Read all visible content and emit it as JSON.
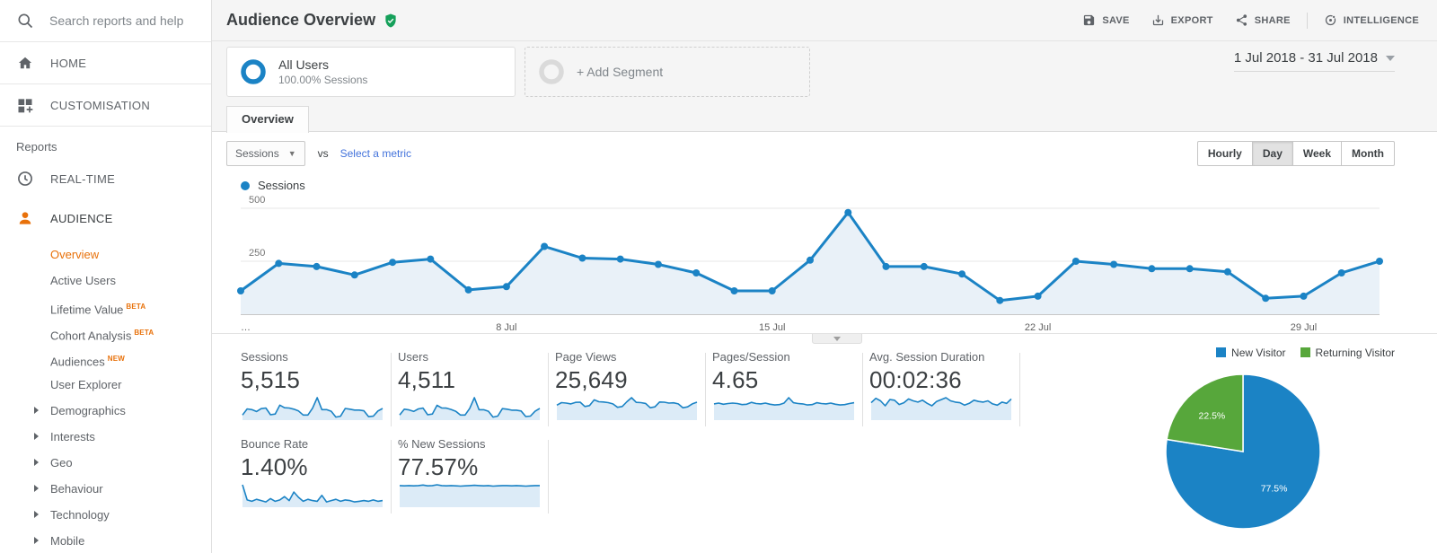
{
  "sidebar": {
    "search_placeholder": "Search reports and help",
    "items": [
      {
        "label": "HOME"
      },
      {
        "label": "CUSTOMISATION"
      }
    ],
    "reports_label": "Reports",
    "report_items": [
      {
        "label": "REAL-TIME"
      },
      {
        "label": "AUDIENCE"
      }
    ],
    "audience_items": [
      {
        "label": "Overview",
        "active": true
      },
      {
        "label": "Active Users"
      },
      {
        "label": "Lifetime Value",
        "badge": "BETA"
      },
      {
        "label": "Cohort Analysis",
        "badge": "BETA"
      },
      {
        "label": "Audiences",
        "badge": "NEW"
      },
      {
        "label": "User Explorer"
      },
      {
        "label": "Demographics",
        "expandable": true
      },
      {
        "label": "Interests",
        "expandable": true
      },
      {
        "label": "Geo",
        "expandable": true
      },
      {
        "label": "Behaviour",
        "expandable": true
      },
      {
        "label": "Technology",
        "expandable": true
      },
      {
        "label": "Mobile",
        "expandable": true
      }
    ]
  },
  "header": {
    "title": "Audience Overview",
    "toolbar": [
      {
        "label": "SAVE"
      },
      {
        "label": "EXPORT"
      },
      {
        "label": "SHARE"
      },
      {
        "label": "INTELLIGENCE"
      }
    ],
    "date_range": "1 Jul 2018 - 31 Jul 2018"
  },
  "segments": {
    "all_users": {
      "title": "All Users",
      "subtitle": "100.00% Sessions"
    },
    "add_segment": {
      "label": "+ Add Segment"
    }
  },
  "tabs": {
    "overview": "Overview"
  },
  "controls": {
    "metric_dropdown": "Sessions",
    "vs_label": "vs",
    "select_metric": "Select a metric",
    "granularity": [
      {
        "label": "Hourly"
      },
      {
        "label": "Day",
        "selected": true
      },
      {
        "label": "Week"
      },
      {
        "label": "Month"
      }
    ]
  },
  "chart_data": [
    {
      "type": "line",
      "legend": "Sessions",
      "color": "#1b83c5",
      "fill": "#e9f1f8",
      "ylim": [
        0,
        500
      ],
      "yticks": [
        250,
        500
      ],
      "x_tick_indices": [
        0,
        7,
        14,
        21,
        28
      ],
      "x_tick_labels": [
        "…",
        "8 Jul",
        "15 Jul",
        "22 Jul",
        "29 Jul"
      ],
      "x_range": [
        "1 Jul 2018",
        "31 Jul 2018"
      ],
      "values": [
        110,
        240,
        225,
        185,
        245,
        260,
        115,
        130,
        320,
        265,
        260,
        235,
        195,
        110,
        110,
        255,
        480,
        225,
        225,
        190,
        65,
        85,
        250,
        235,
        215,
        215,
        200,
        75,
        85,
        195,
        250
      ]
    },
    {
      "type": "pie",
      "title": "New vs Returning",
      "legend_position": "top",
      "slices": [
        {
          "label": "New Visitor",
          "value": 77.5,
          "text": "77.5%",
          "color": "#1b83c5"
        },
        {
          "label": "Returning Visitor",
          "value": 22.5,
          "text": "22.5%",
          "color": "#57a73b"
        }
      ]
    }
  ],
  "scorecards": [
    {
      "label": "Sessions",
      "value": "5,515",
      "spark": [
        110,
        240,
        225,
        185,
        245,
        260,
        115,
        130,
        320,
        265,
        260,
        235,
        195,
        110,
        110,
        255,
        480,
        225,
        225,
        190,
        65,
        85,
        250,
        235,
        215,
        215,
        200,
        75,
        85,
        195,
        250
      ]
    },
    {
      "label": "Users",
      "value": "4,511",
      "spark": [
        100,
        215,
        200,
        170,
        220,
        235,
        105,
        120,
        290,
        240,
        235,
        210,
        175,
        100,
        100,
        230,
        440,
        205,
        205,
        175,
        60,
        80,
        225,
        215,
        195,
        195,
        180,
        70,
        80,
        175,
        230
      ]
    },
    {
      "label": "Page Views",
      "value": "25,649",
      "spark": [
        700,
        820,
        800,
        760,
        830,
        840,
        640,
        680,
        950,
        860,
        850,
        820,
        760,
        600,
        640,
        860,
        1050,
        830,
        820,
        780,
        580,
        620,
        850,
        840,
        800,
        810,
        760,
        580,
        620,
        760,
        840
      ]
    },
    {
      "label": "Pages/Session",
      "value": "4.65",
      "spark": [
        4.5,
        4.7,
        4.4,
        4.6,
        4.7,
        4.6,
        4.3,
        4.4,
        4.9,
        4.6,
        4.5,
        4.7,
        4.4,
        4.2,
        4.3,
        4.7,
        6.2,
        4.8,
        4.6,
        4.5,
        4.2,
        4.3,
        4.8,
        4.6,
        4.5,
        4.7,
        4.4,
        4.2,
        4.3,
        4.6,
        4.8
      ]
    },
    {
      "label": "Avg. Session Duration",
      "value": "00:02:36",
      "spark": [
        140,
        175,
        155,
        115,
        165,
        160,
        125,
        140,
        170,
        155,
        145,
        160,
        135,
        115,
        150,
        165,
        180,
        155,
        145,
        140,
        120,
        135,
        160,
        150,
        145,
        155,
        130,
        120,
        145,
        135,
        170
      ]
    },
    {
      "label": "Bounce Rate",
      "value": "1.40%",
      "spark": [
        3.4,
        1.1,
        0.9,
        1.2,
        1.0,
        0.8,
        1.3,
        0.9,
        1.1,
        1.6,
        1.0,
        2.3,
        1.5,
        0.9,
        1.2,
        1.0,
        0.9,
        1.8,
        0.8,
        1.0,
        1.2,
        0.9,
        1.1,
        1.0,
        0.8,
        0.9,
        1.0,
        0.9,
        1.1,
        0.9,
        1.0
      ]
    },
    {
      "label": "% New Sessions",
      "value": "77.57%",
      "spark": [
        78,
        77,
        78,
        77,
        78,
        80,
        77,
        78,
        81,
        78,
        77,
        78,
        77,
        76,
        77,
        78,
        79,
        78,
        77,
        78,
        76,
        77,
        78,
        78,
        77,
        78,
        77,
        76,
        77,
        78,
        78
      ]
    }
  ]
}
